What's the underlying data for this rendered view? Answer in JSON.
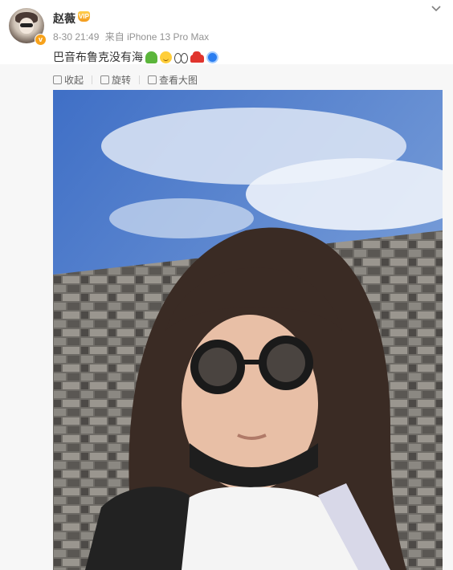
{
  "post": {
    "username": "赵薇",
    "member_badge": "VIP",
    "verified_badge": "v",
    "time": "8-30 21:49",
    "source": "来自 iPhone 13 Pro Max",
    "text": "巴音布鲁克没有海"
  },
  "toolbar": {
    "collapse": "收起",
    "rotate": "旋转",
    "view_large": "查看大图"
  },
  "icons": {
    "more": "chevron-down-icon",
    "emojis": [
      "green-figure-emoji",
      "smile-emoji",
      "eyes-emoji",
      "red-car-emoji",
      "blue-stone-emoji"
    ]
  },
  "colors": {
    "sky": "#5f88cf",
    "verified": "#f7a21b",
    "muted_text": "#939393"
  }
}
